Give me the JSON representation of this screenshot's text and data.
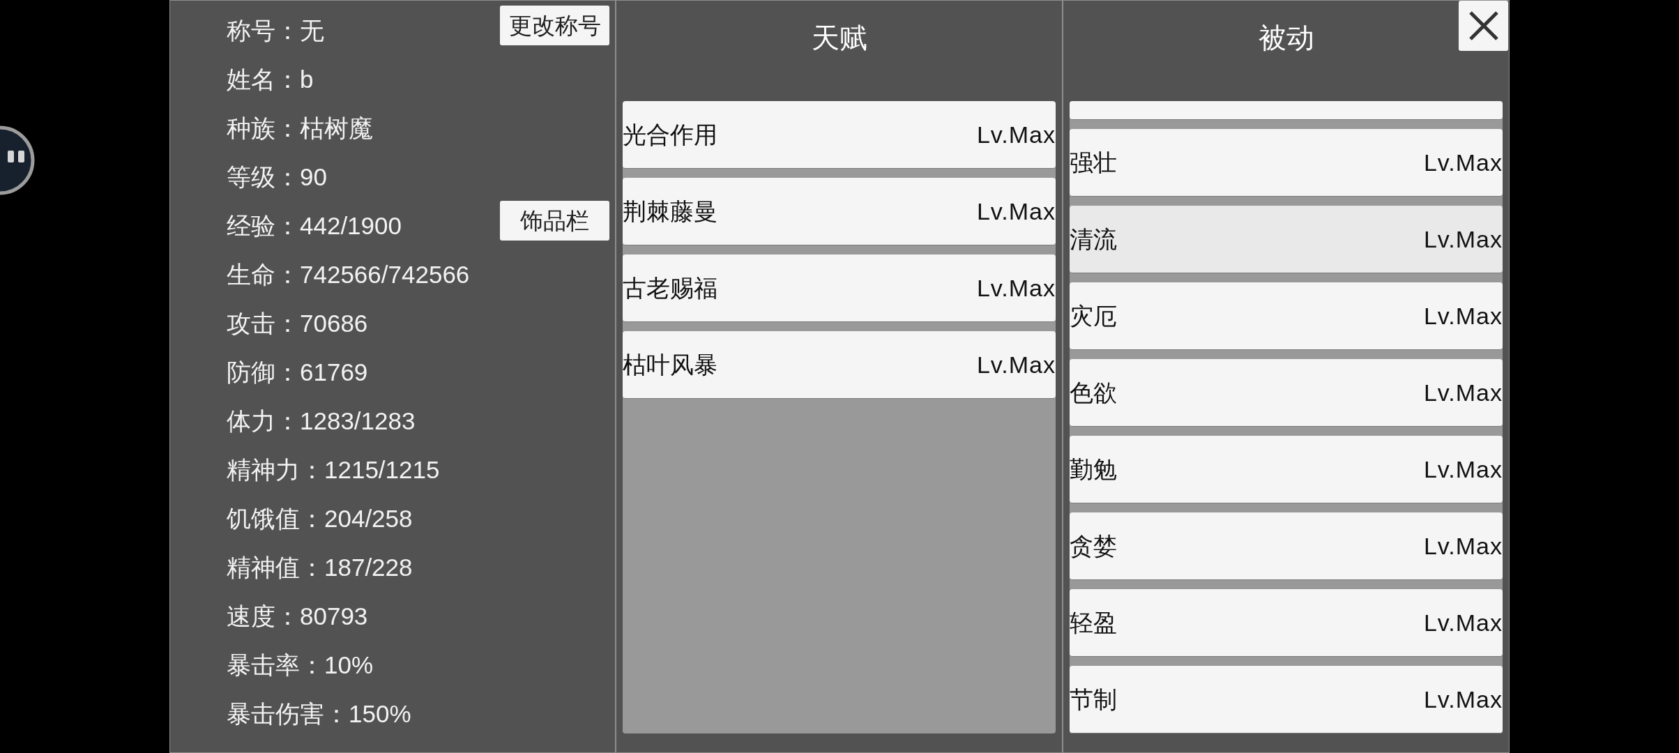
{
  "stats_panel": {
    "stats": [
      {
        "label": "称号：",
        "value": "无",
        "button": "更改称号"
      },
      {
        "label": "姓名：",
        "value": "b"
      },
      {
        "label": "种族：",
        "value": "枯树魔"
      },
      {
        "label": "等级：",
        "value": "90"
      },
      {
        "label": "经验：",
        "value": "442/1900",
        "button": "饰品栏"
      },
      {
        "label": "生命：",
        "value": "742566/742566"
      },
      {
        "label": "攻击：",
        "value": "70686"
      },
      {
        "label": "防御：",
        "value": "61769"
      },
      {
        "label": "体力：",
        "value": "1283/1283"
      },
      {
        "label": "精神力：",
        "value": "1215/1215"
      },
      {
        "label": "饥饿值：",
        "value": "204/258"
      },
      {
        "label": "精神值：",
        "value": "187/228"
      },
      {
        "label": "速度：",
        "value": "80793"
      },
      {
        "label": "暴击率：",
        "value": "10%"
      },
      {
        "label": "暴击伤害：",
        "value": "150%"
      }
    ]
  },
  "panels": [
    {
      "title": "天赋",
      "closable": false,
      "scrolled": false,
      "items": [
        {
          "name": "光合作用",
          "rank": "Lv.Max",
          "selected": false
        },
        {
          "name": "荆棘藤曼",
          "rank": "Lv.Max",
          "selected": false
        },
        {
          "name": "古老赐福",
          "rank": "Lv.Max",
          "selected": false
        },
        {
          "name": "枯叶风暴",
          "rank": "Lv.Max",
          "selected": false
        }
      ]
    },
    {
      "title": "被动",
      "closable": true,
      "scrolled": true,
      "items": [
        {
          "name": "强壮",
          "rank": "Lv.Max",
          "selected": false
        },
        {
          "name": "清流",
          "rank": "Lv.Max",
          "selected": true
        },
        {
          "name": "灾厄",
          "rank": "Lv.Max",
          "selected": false
        },
        {
          "name": "色欲",
          "rank": "Lv.Max",
          "selected": false
        },
        {
          "name": "勤勉",
          "rank": "Lv.Max",
          "selected": false
        },
        {
          "name": "贪婪",
          "rank": "Lv.Max",
          "selected": false
        },
        {
          "name": "轻盈",
          "rank": "Lv.Max",
          "selected": false
        },
        {
          "name": "节制",
          "rank": "Lv.Max",
          "selected": false
        }
      ]
    }
  ]
}
